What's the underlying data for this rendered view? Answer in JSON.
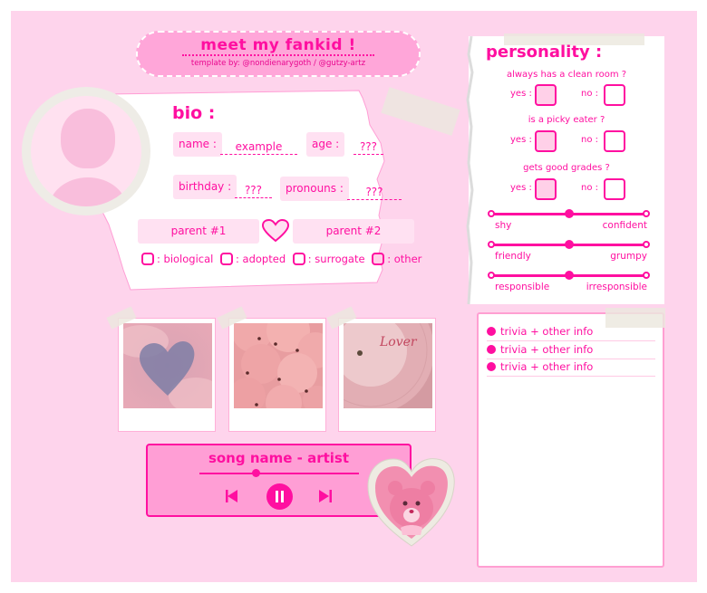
{
  "header": {
    "title": "meet my fankid !",
    "credit": "template by: @nondienarygoth / @gutzy-artz"
  },
  "avatar": {
    "icon": "user-avatar-placeholder-icon"
  },
  "bio": {
    "title": "bio :",
    "fields": [
      {
        "label": "name :",
        "value": "example"
      },
      {
        "label": "age :",
        "value": "???"
      },
      {
        "label": "birthday :",
        "value": "???"
      },
      {
        "label": "pronouns :",
        "value": "???"
      }
    ],
    "parents": [
      "parent #1",
      "parent #2"
    ],
    "parent_heart_icon": "heart-outline-icon",
    "relation_options": [
      {
        "label": ": biological",
        "checked": false
      },
      {
        "label": ": adopted",
        "checked": false
      },
      {
        "label": ": surrogate",
        "checked": false
      },
      {
        "label": ": other",
        "checked": true
      }
    ]
  },
  "personality": {
    "title": "personality :",
    "questions": [
      {
        "text": "always has a clean room ?",
        "yes_label": "yes :",
        "no_label": "no :",
        "yes_checked": true,
        "no_checked": false
      },
      {
        "text": "is a picky eater ?",
        "yes_label": "yes :",
        "no_label": "no :",
        "yes_checked": true,
        "no_checked": false
      },
      {
        "text": "gets good grades ?",
        "yes_label": "yes :",
        "no_label": "no :",
        "yes_checked": true,
        "no_checked": false
      }
    ],
    "sliders": [
      {
        "left": "shy",
        "right": "confident",
        "value": 0.5
      },
      {
        "left": "friendly",
        "right": "grumpy",
        "value": 0.5
      },
      {
        "left": "responsible",
        "right": "irresponsible",
        "value": 0.5
      }
    ]
  },
  "trivia": {
    "items": [
      "trivia + other info",
      "trivia + other info",
      "trivia + other info"
    ]
  },
  "gallery": {
    "photos": [
      {
        "name": "heart-cloud-photo",
        "description": "pink sky with heart-shaped cloud"
      },
      {
        "name": "pink-balloons-photo",
        "description": "pink balloons"
      },
      {
        "name": "lover-vinyl-photo",
        "description": "pink vinyl record",
        "label": "Lover"
      }
    ]
  },
  "player": {
    "song": "song name - artist",
    "progress": 0.35,
    "state": "playing",
    "controls": [
      "previous",
      "pause",
      "next"
    ],
    "sticker": "care-bear-heart-sticker"
  },
  "colors": {
    "accent": "#ff0fa0",
    "background": "#fed4ec",
    "pill": "#ffa6d9",
    "light_pink": "#ffe1f2"
  }
}
